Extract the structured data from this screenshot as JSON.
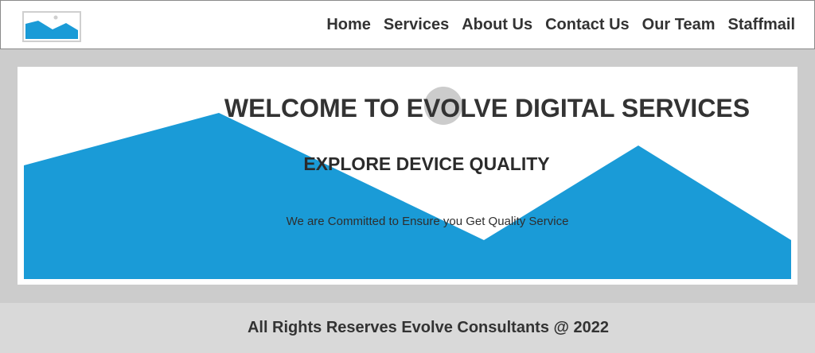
{
  "nav": {
    "items": [
      "Home",
      "Services",
      "About Us",
      "Contact Us",
      "Our Team",
      "Staffmail"
    ]
  },
  "hero": {
    "title": "WELCOME TO EVOLVE DIGITAL SERVICES",
    "subtitle": "EXPLORE DEVICE QUALITY",
    "tagline": "We are Committed to Ensure you Get Quality Service"
  },
  "footer": {
    "text": "All Rights Reserves Evolve Consultants @ 2022"
  },
  "colors": {
    "accent": "#1a9bd7",
    "background": "#cccccc",
    "text": "#333333"
  },
  "icons": {
    "logo": "image-placeholder-icon"
  }
}
